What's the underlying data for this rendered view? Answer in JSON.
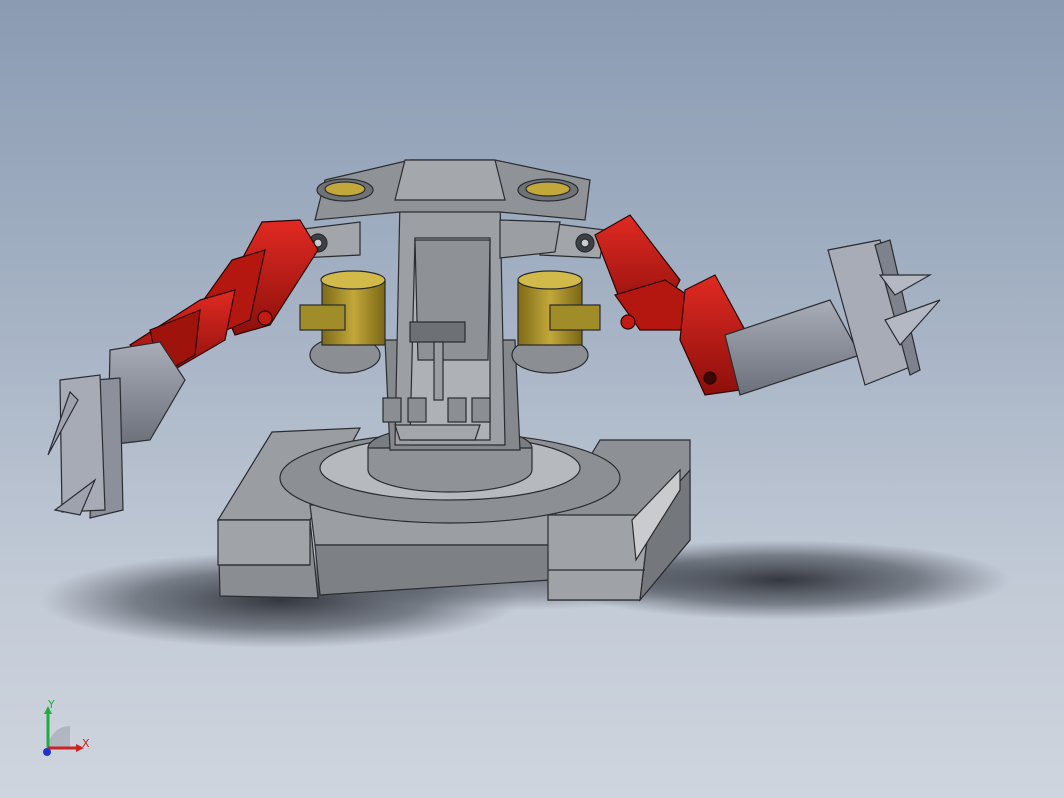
{
  "viewport": {
    "background_top": "#8a9bb2",
    "background_bottom": "#cfd5de"
  },
  "model": {
    "parts": [
      "track-base",
      "turntable",
      "mast-body",
      "left-arm",
      "right-arm",
      "left-gripper",
      "right-gripper",
      "control-lever",
      "bushings"
    ],
    "colors": {
      "body": "#8e9196",
      "body_dark": "#5f6368",
      "arm_red": "#c41a14",
      "bushing_gold": "#b39a2c",
      "tool_gray": "#8b8f99"
    }
  },
  "triad": {
    "x_label": "X",
    "y_label": "Y",
    "x_color": "#cc2222",
    "y_color": "#22aa44",
    "z_color": "#2233cc"
  }
}
